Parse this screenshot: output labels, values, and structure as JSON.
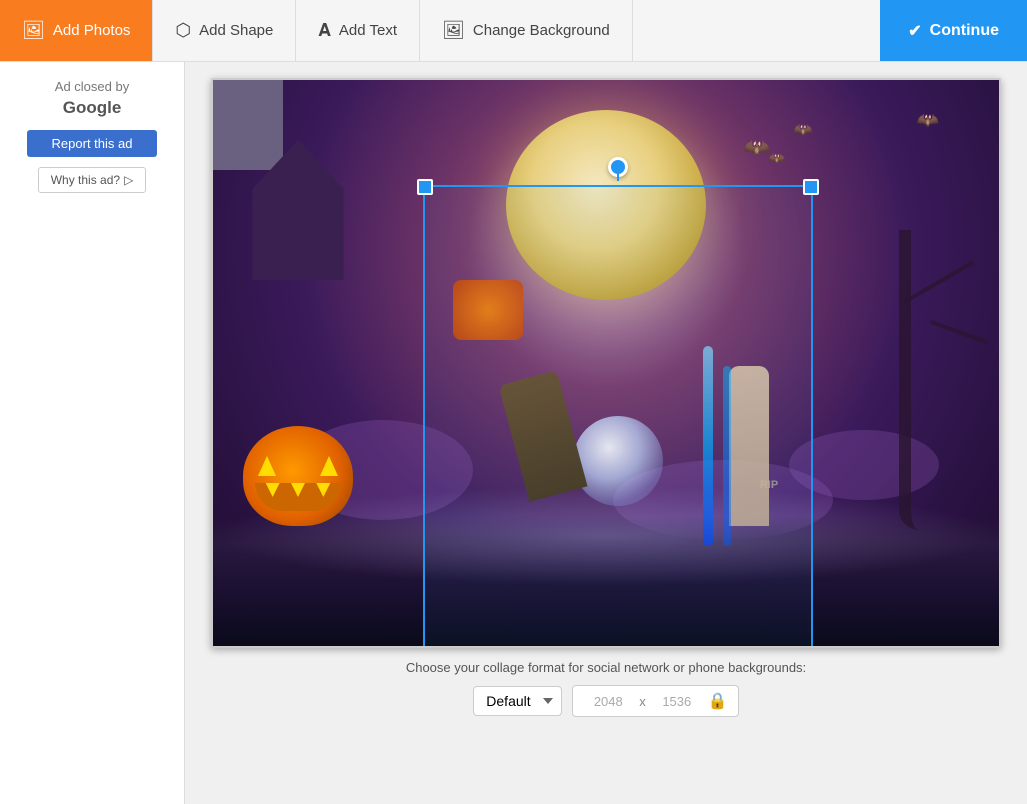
{
  "toolbar": {
    "add_photos_label": "Add Photos",
    "add_shape_label": "Add Shape",
    "add_text_label": "Add Text",
    "change_background_label": "Change Background",
    "continue_label": "Continue"
  },
  "ad_panel": {
    "ad_closed_line1": "Ad closed by",
    "google_text": "Google",
    "report_button": "Report this ad",
    "why_button": "Why this ad?"
  },
  "bottom_bar": {
    "instruction": "Choose your collage format for social network or phone backgrounds:",
    "format_default": "Default",
    "width": "2048",
    "x_separator": "x",
    "height": "1536"
  }
}
